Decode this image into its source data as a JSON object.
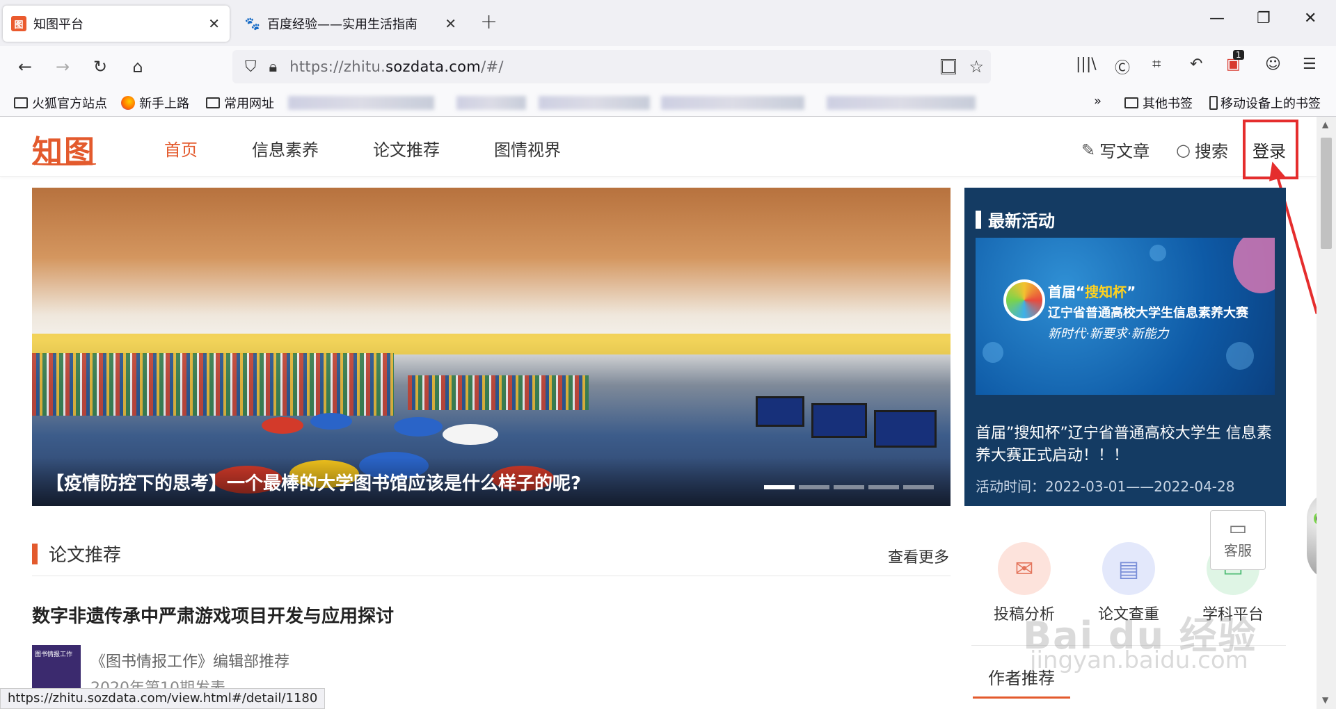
{
  "browser": {
    "tabs": [
      {
        "title": "知图平台",
        "favicon": "zhitu-icon",
        "active": true
      },
      {
        "title": "百度经验——实用生活指南",
        "favicon": "baidu-icon",
        "active": false
      }
    ],
    "new_tab": "+",
    "window": {
      "minimize": "—",
      "restore": "❐",
      "close": "✕"
    },
    "nav": {
      "back": "←",
      "forward": "→",
      "reload": "↻",
      "home": "⌂"
    },
    "url_prefix": "https://zhitu.",
    "url_domain": "sozdata.com",
    "url_suffix": "/#/",
    "bookmarks": [
      {
        "label": "火狐官方站点",
        "icon": "folder-icon"
      },
      {
        "label": "新手上路",
        "icon": "firefox-icon"
      },
      {
        "label": "常用网址",
        "icon": "folder-icon"
      }
    ],
    "bookmarks_right": [
      {
        "label": "»",
        "icon": "chevron-right-icon"
      },
      {
        "label": "其他书签",
        "icon": "folder-icon"
      },
      {
        "label": "移动设备上的书签",
        "icon": "mobile-icon"
      }
    ],
    "extension_badge": "1",
    "status_url": "https://zhitu.sozdata.com/view.html#/detail/1180"
  },
  "site": {
    "logo": "知图",
    "menu": [
      "首页",
      "信息素养",
      "论文推荐",
      "图情视界"
    ],
    "write": "写文章",
    "search": "搜索",
    "login": "登录",
    "accent": "#e35a2d"
  },
  "banner": {
    "title": "【疫情防控下的思考】一个最棒的大学图书馆应该是什么样子的呢?",
    "slides": 5,
    "active_slide": 1
  },
  "activity": {
    "heading": "最新活动",
    "img_line1_a": "首届“",
    "img_line1_b": "搜知杯",
    "img_line1_c": "”",
    "img_line2": "辽宁省普通高校大学生信息素养大赛",
    "img_line3": "新时代·新要求·新能力",
    "text": "首届”搜知杯”辽宁省普通高校大学生 信息素养大赛正式启动！！！",
    "date": "活动时间：2022-03-01——2022-04-28",
    "bg": "#143b63"
  },
  "papers": {
    "heading": "论文推荐",
    "more": "查看更多",
    "item_title": "数字非遗传承中严肃游戏项目开发与应用探讨",
    "cover_text": "图书情报工作",
    "source": "《图书情报工作》编辑部推荐",
    "issue": "2020年第10期发表"
  },
  "services": [
    {
      "label": "投稿分析",
      "icon": "mail-icon",
      "color": "#fde3dc"
    },
    {
      "label": "论文查重",
      "icon": "document-icon",
      "color": "#e3e8fb"
    },
    {
      "label": "学科平台",
      "icon": "book-icon",
      "color": "#dff5e5"
    }
  ],
  "kefu": "客服",
  "author_heading": "作者推荐",
  "watermark": "Bai du 经验",
  "watermark_url": "jingyan.baidu.com"
}
